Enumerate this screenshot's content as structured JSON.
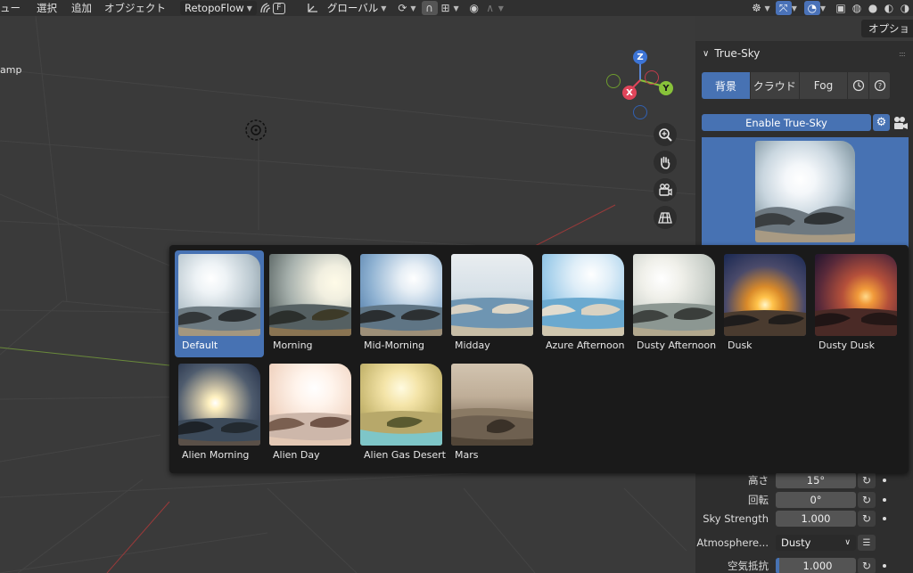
{
  "header": {
    "menus": [
      "ュー",
      "選択",
      "追加",
      "オブジェクト"
    ],
    "retopo": "RetopoFlow",
    "fkey": "F",
    "transform": "グローバル"
  },
  "viewport": {
    "options_button": "オプション",
    "lamp_label": "amp",
    "gizmo": {
      "z": "Z",
      "y": "Y",
      "x": "X"
    }
  },
  "panel": {
    "title": "True-Sky",
    "tabs": [
      "背景",
      "クラウド",
      "Fog"
    ],
    "enable_button": "Enable True-Sky",
    "props": {
      "height": {
        "label": "高さ",
        "value": "15°"
      },
      "rotation": {
        "label": "回転",
        "value": "0°"
      },
      "sky_strength": {
        "label": "Sky Strength",
        "value": "1.000"
      },
      "atmosphere": {
        "label": "Atmosphere...",
        "value": "Dusty"
      },
      "air_resistance": {
        "label": "空気抵抗",
        "value": "1.000"
      }
    }
  },
  "presets": [
    {
      "label": "Default",
      "selected": true
    },
    {
      "label": "Morning"
    },
    {
      "label": "Mid-Morning"
    },
    {
      "label": "Midday"
    },
    {
      "label": "Azure Afternoon"
    },
    {
      "label": "Dusty Afternoon"
    },
    {
      "label": "Dusk"
    },
    {
      "label": "Dusty Dusk"
    },
    {
      "label": "Alien Morning"
    },
    {
      "label": "Alien Day"
    },
    {
      "label": "Alien Gas Desert"
    },
    {
      "label": "Mars"
    }
  ],
  "colors": {
    "accent": "#4772b3",
    "popup_bg": "#1a1a1a",
    "panel_bg": "#2e2e2e"
  }
}
